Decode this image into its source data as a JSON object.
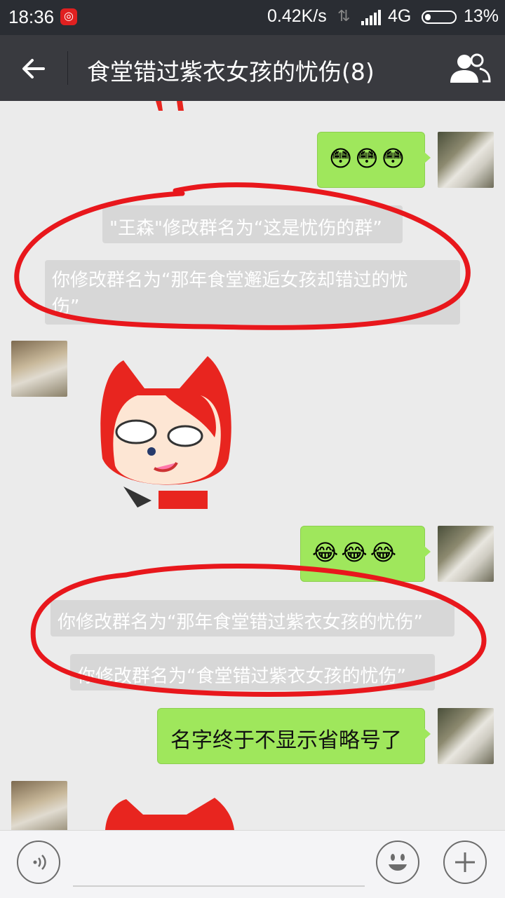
{
  "status_bar": {
    "time": "18:36",
    "app_icon": "netease-music-icon",
    "net_speed": "0.42K/s",
    "network": "4G",
    "battery": "13%"
  },
  "header": {
    "back_icon": "arrow-left-icon",
    "title": "食堂错过紫衣女孩的忧伤(8)",
    "members_icon": "group-members-icon"
  },
  "messages": {
    "m1_emojis": "😳😳😳",
    "sys1": "\"王森\"修改群名为“这是忧伤的群”",
    "sys2_line1": "你修改群名为“那年食堂邂逅女孩却错过的忧",
    "sys2_line2": "伤”",
    "m2_emojis": "😂😂😂",
    "sys3": "你修改群名为“那年食堂错过紫衣女孩的忧伤”",
    "sys4": "你修改群名为“食堂错过紫衣女孩的忧伤”",
    "m3_text": "名字终于不显示省略号了"
  },
  "colors": {
    "header_bg": "#393a3f",
    "status_bg": "#2a2d33",
    "chat_bg": "#ebebeb",
    "my_bubble": "#9fe75c",
    "system_bg": "#d7d7d7",
    "annotation_red": "#e8171c"
  }
}
